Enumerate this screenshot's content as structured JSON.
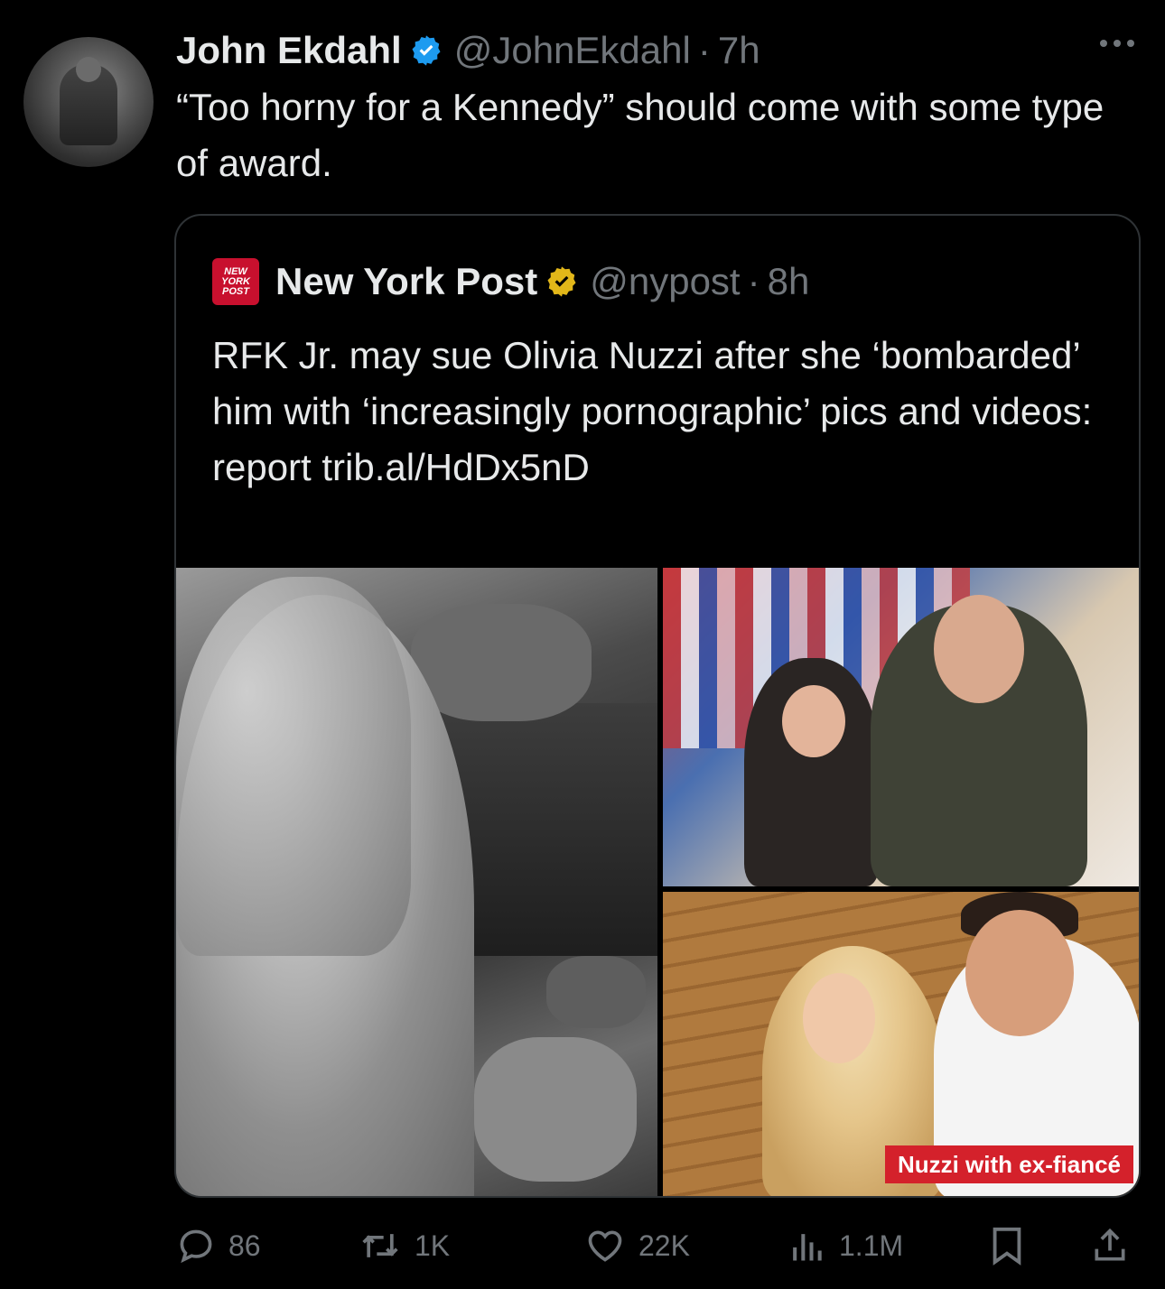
{
  "tweet": {
    "author_name": "John Ekdahl",
    "handle": "@JohnEkdahl",
    "time": "7h",
    "text": "“Too horny for a Kennedy” should come with some type of award."
  },
  "quoted": {
    "logo_lines": [
      "NEW",
      "YORK",
      "POST"
    ],
    "author_name": "New York Post",
    "handle": "@nypost",
    "time": "8h",
    "text": "RFK Jr. may sue Olivia Nuzzi after she ‘bombarded’ him with ‘increasingly pornographic’ pics and videos: report trib.al/HdDx5nD",
    "image_caption": "Nuzzi with ex-fiancé"
  },
  "actions": {
    "replies": "86",
    "reposts": "1K",
    "likes": "22K",
    "views": "1.1M"
  },
  "colors": {
    "background": "#000000",
    "text": "#e7e9ea",
    "muted": "#71767b",
    "verified_blue": "#1d9bf0",
    "verified_gold": "#e2b719",
    "nyp_red": "#c8102e"
  }
}
